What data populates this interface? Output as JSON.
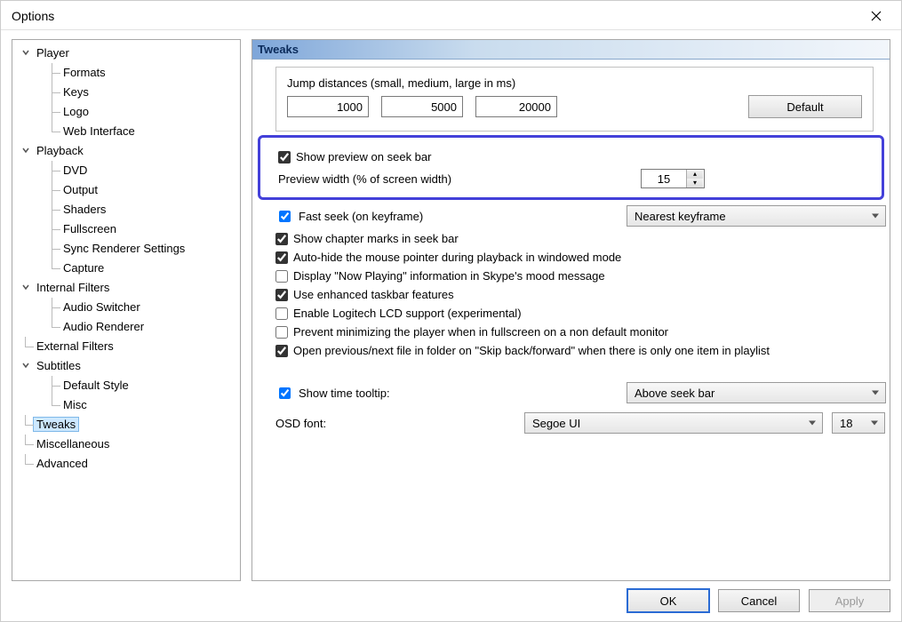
{
  "window": {
    "title": "Options"
  },
  "tree": {
    "player": {
      "label": "Player",
      "children": [
        "Formats",
        "Keys",
        "Logo",
        "Web Interface"
      ]
    },
    "playback": {
      "label": "Playback",
      "children": [
        "DVD",
        "Output",
        "Shaders",
        "Fullscreen",
        "Sync Renderer Settings",
        "Capture"
      ]
    },
    "internal_filters": {
      "label": "Internal Filters",
      "children": [
        "Audio Switcher",
        "Audio Renderer"
      ]
    },
    "external_filters": {
      "label": "External Filters"
    },
    "subtitles": {
      "label": "Subtitles",
      "children": [
        "Default Style",
        "Misc"
      ]
    },
    "tweaks": {
      "label": "Tweaks"
    },
    "misc": {
      "label": "Miscellaneous"
    },
    "advanced": {
      "label": "Advanced"
    }
  },
  "header": "Tweaks",
  "jump": {
    "label": "Jump distances (small, medium, large in ms)",
    "small": "1000",
    "medium": "5000",
    "large": "20000",
    "default_btn": "Default"
  },
  "preview": {
    "show_label": "Show preview on seek bar",
    "show_checked": true,
    "width_label": "Preview width (% of screen width)",
    "width_value": "15"
  },
  "fast_seek": {
    "label": "Fast seek (on keyframe)",
    "checked": true,
    "mode": "Nearest keyframe"
  },
  "checks": {
    "chapter_marks": {
      "label": "Show chapter marks in seek bar",
      "checked": true
    },
    "autohide_mouse": {
      "label": "Auto-hide the mouse pointer during playback in windowed mode",
      "checked": true
    },
    "skype": {
      "label": "Display \"Now Playing\" information in Skype's mood message",
      "checked": false
    },
    "taskbar": {
      "label": "Use enhanced taskbar features",
      "checked": true
    },
    "logitech": {
      "label": "Enable Logitech LCD support (experimental)",
      "checked": false
    },
    "prevent_min": {
      "label": "Prevent minimizing the player when in fullscreen on a non default monitor",
      "checked": false
    },
    "open_prev_next": {
      "label": "Open previous/next file in folder on \"Skip back/forward\" when there is only one item in playlist",
      "checked": true
    }
  },
  "time_tooltip": {
    "label": "Show time tooltip:",
    "checked": true,
    "value": "Above seek bar"
  },
  "osd": {
    "label": "OSD font:",
    "font": "Segoe UI",
    "size": "18"
  },
  "footer": {
    "ok": "OK",
    "cancel": "Cancel",
    "apply": "Apply"
  }
}
